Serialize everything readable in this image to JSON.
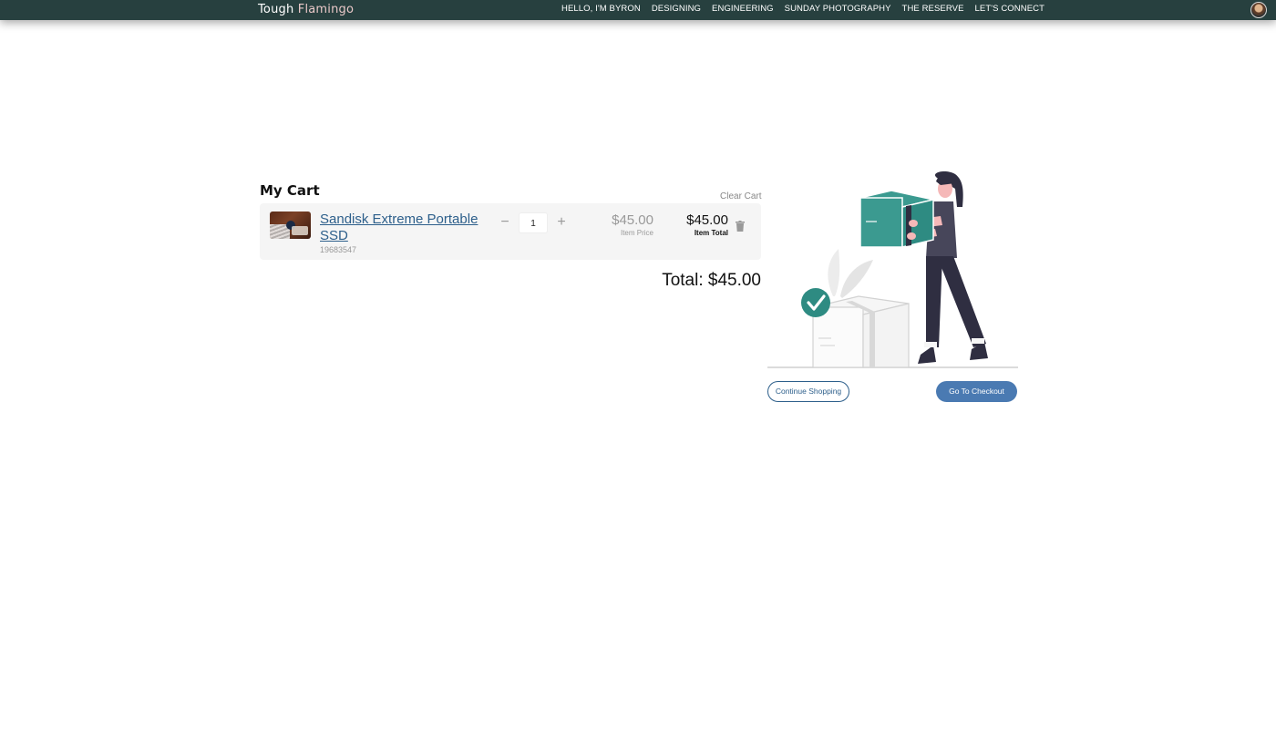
{
  "header": {
    "brand_part1": "Tough",
    "brand_part2": "Flamingo",
    "nav": [
      {
        "label": "HELLO, I'M BYRON"
      },
      {
        "label": "DESIGNING"
      },
      {
        "label": "ENGINEERING"
      },
      {
        "label": "SUNDAY PHOTOGRAPHY"
      },
      {
        "label": "THE RESERVE"
      },
      {
        "label": "LET'S CONNECT"
      }
    ],
    "avatar_icon": "user-avatar-icon"
  },
  "cart": {
    "title": "My Cart",
    "clear_label": "Clear Cart",
    "items": [
      {
        "name": "Sandisk Extreme Portable SSD",
        "sku": "19683547",
        "quantity": "1",
        "minus_glyph": "−",
        "plus_glyph": "+",
        "price": "$45.00",
        "price_label": "Item Price",
        "total": "$45.00",
        "total_label": "Item Total",
        "remove_icon": "trash-icon",
        "image_icon": "product-thumbnail"
      }
    ],
    "total": "Total: $45.00"
  },
  "actions": {
    "continue_label": "Continue Shopping",
    "checkout_label": "Go To Checkout"
  },
  "colors": {
    "nav_bg": "#27403f",
    "link": "#2d5f8b",
    "checkout_button": "#4a7ab2",
    "accent_teal": "#2e8b82"
  }
}
